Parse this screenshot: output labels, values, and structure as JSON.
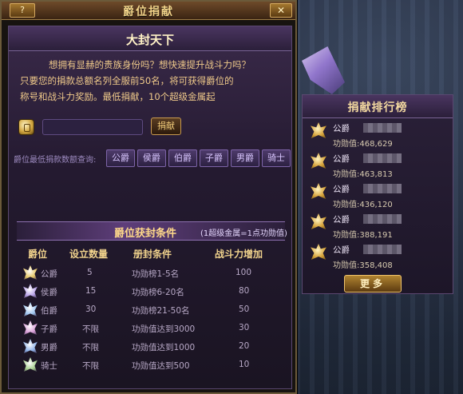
{
  "window": {
    "title": "爵位捐献",
    "help_label": "?",
    "close_label": "✕"
  },
  "header": {
    "subtitle": "大封天下"
  },
  "description": {
    "line1": "想拥有显赫的贵族身份吗？想快速提升战斗力吗？",
    "line2": "只要您的捐款总额名列全服前50名，将可获得爵位的",
    "line3": "称号和战斗力奖励。最低捐献，10个超级金属起"
  },
  "donate": {
    "input_value": "",
    "button_label": "捐献",
    "icon": "coin-icon"
  },
  "query": {
    "label": "爵位最低捐款数额查询:",
    "buttons": [
      "公爵",
      "侯爵",
      "伯爵",
      "子爵",
      "男爵",
      "骑士"
    ]
  },
  "conditions": {
    "title": "爵位获封条件",
    "note": "(1超级金属=1点功勋值)",
    "columns": [
      "爵位",
      "设立数量",
      "册封条件",
      "战斗力增加"
    ],
    "rows": [
      {
        "rank": "公爵",
        "count": "5",
        "condition": "功勋榜1-5名",
        "power": "100",
        "color": "#e8c96a"
      },
      {
        "rank": "侯爵",
        "count": "15",
        "condition": "功勋榜6-20名",
        "power": "80",
        "color": "#b9a4e8"
      },
      {
        "rank": "伯爵",
        "count": "30",
        "condition": "功勋榜21-50名",
        "power": "50",
        "color": "#9fc6ef"
      },
      {
        "rank": "子爵",
        "count": "不限",
        "condition": "功勋值达到3000",
        "power": "30",
        "color": "#d9a0d8"
      },
      {
        "rank": "男爵",
        "count": "不限",
        "condition": "功勋值达到1000",
        "power": "20",
        "color": "#8fb2e8"
      },
      {
        "rank": "骑士",
        "count": "不限",
        "condition": "功勋值达到500",
        "power": "10",
        "color": "#a8d090"
      }
    ]
  },
  "leaderboard": {
    "title": "捐献排行榜",
    "more_label": "更多",
    "entries": [
      {
        "title": "公爵",
        "score": "功勋值:468,629"
      },
      {
        "title": "公爵",
        "score": "功勋值:463,813"
      },
      {
        "title": "公爵",
        "score": "功勋值:436,120"
      },
      {
        "title": "公爵",
        "score": "功勋值:388,191"
      },
      {
        "title": "公爵",
        "score": "功勋值:358,408"
      }
    ]
  }
}
